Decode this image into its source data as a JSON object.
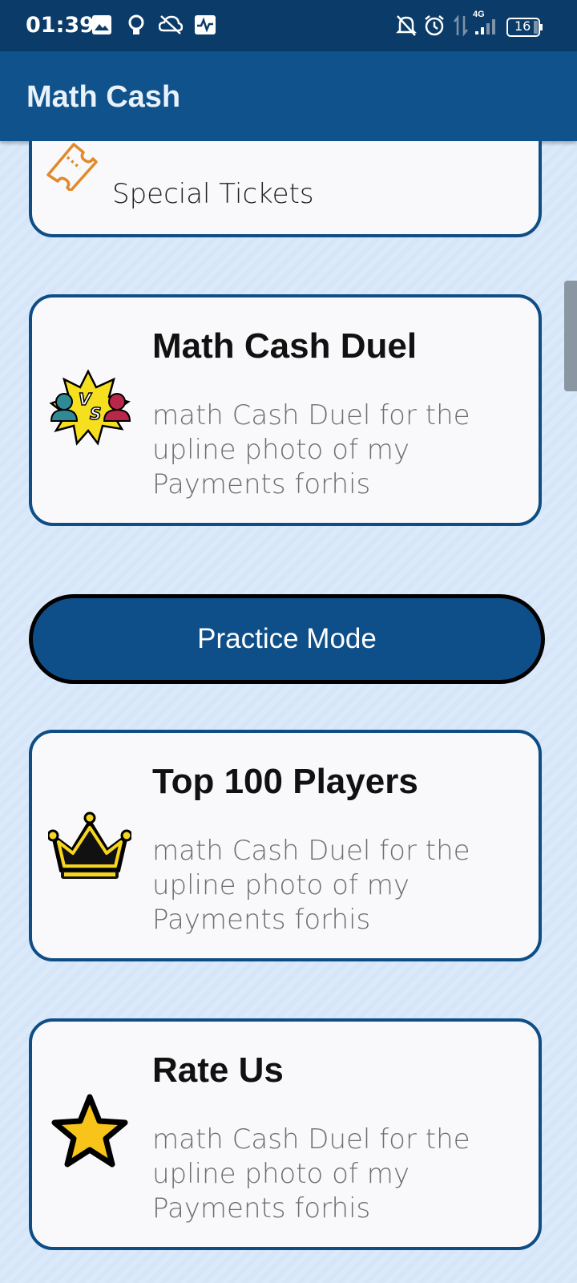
{
  "status_bar": {
    "time": "01:39",
    "network": "4G",
    "battery": "16"
  },
  "app_bar": {
    "title": "Math Cash"
  },
  "cards": {
    "special_tickets": {
      "label": "Special Tickets",
      "icon": "ticket-icon"
    },
    "duel": {
      "title": "Math Cash Duel",
      "description": "math Cash Duel for the upline photo of my Payments forhis",
      "icon": "vs-icon"
    },
    "top_players": {
      "title": "Top 100 Players",
      "description": "math Cash Duel for the upline photo of my Payments forhis",
      "icon": "crown-icon"
    },
    "rate_us": {
      "title": "Rate Us",
      "description": "math Cash Duel for the upline photo of my Payments forhis",
      "icon": "star-icon"
    }
  },
  "practice_button": {
    "label": "Practice Mode"
  },
  "colors": {
    "status_bar": "#0b3b68",
    "app_bar": "#0f528c",
    "card_border": "#0f4d85",
    "button": "#0f4f89",
    "background": "#d6e6f8"
  }
}
